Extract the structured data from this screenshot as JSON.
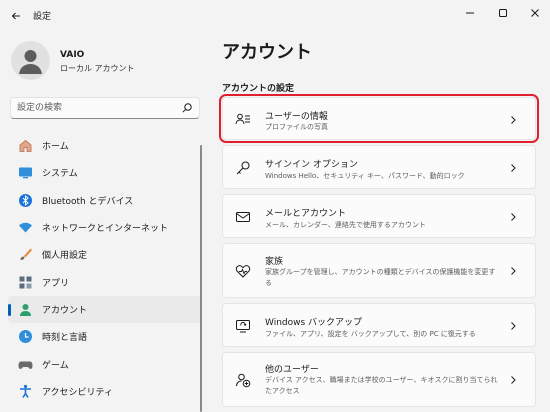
{
  "window": {
    "title": "設定"
  },
  "user": {
    "name": "VAIO",
    "account_type": "ローカル アカウント"
  },
  "search": {
    "placeholder": "設定の検索"
  },
  "nav": {
    "items": [
      {
        "label": "ホーム",
        "icon": "home-icon"
      },
      {
        "label": "システム",
        "icon": "system-icon"
      },
      {
        "label": "Bluetooth とデバイス",
        "icon": "bluetooth-icon"
      },
      {
        "label": "ネットワークとインターネット",
        "icon": "network-icon"
      },
      {
        "label": "個人用設定",
        "icon": "brush-icon"
      },
      {
        "label": "アプリ",
        "icon": "apps-icon"
      },
      {
        "label": "アカウント",
        "icon": "accounts-icon",
        "active": true
      },
      {
        "label": "時刻と言語",
        "icon": "time-language-icon"
      },
      {
        "label": "ゲーム",
        "icon": "gaming-icon"
      },
      {
        "label": "アクセシビリティ",
        "icon": "accessibility-icon"
      }
    ]
  },
  "main": {
    "title": "アカウント",
    "section_title": "アカウントの設定",
    "cards": [
      {
        "title": "ユーザーの情報",
        "desc": "プロファイルの写真",
        "icon": "user-info-icon",
        "highlighted": true
      },
      {
        "title": "サインイン オプション",
        "desc": "Windows Hello、セキュリティ キー、パスワード、動的ロック",
        "icon": "key-icon"
      },
      {
        "title": "メールとアカウント",
        "desc": "メール、カレンダー、連絡先で使用するアカウント",
        "icon": "mail-icon"
      },
      {
        "title": "家族",
        "desc": "家族グループを管理し、アカウントの種類とデバイスの保護機能を変更する",
        "icon": "family-heart-icon"
      },
      {
        "title": "Windows バックアップ",
        "desc": "ファイル、アプリ、設定を バックアップして、別の PC に復元する",
        "icon": "backup-icon"
      },
      {
        "title": "他のユーザー",
        "desc": "デバイス アクセス、職場または学校のユーザー、キオスクに割り当てられたアクセス",
        "icon": "add-user-icon"
      }
    ]
  },
  "colors": {
    "accent": "#005fb8",
    "highlight_border": "#e0202e",
    "background": "#f3f3f3"
  }
}
